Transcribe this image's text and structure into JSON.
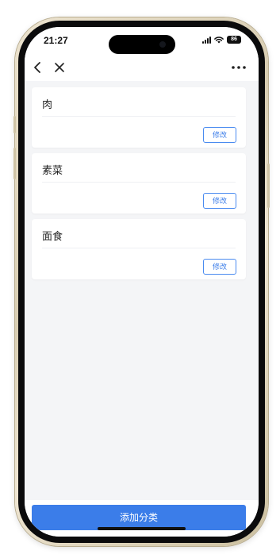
{
  "status_bar": {
    "time": "21:27",
    "battery": "86",
    "icons": [
      "signal-icon",
      "wifi-icon",
      "battery-icon"
    ]
  },
  "nav": {
    "back_icon": "chevron-left-icon",
    "close_icon": "close-icon",
    "more_icon": "more-horizontal-icon"
  },
  "categories": [
    {
      "name": "肉",
      "edit_label": "修改"
    },
    {
      "name": "素菜",
      "edit_label": "修改"
    },
    {
      "name": "面食",
      "edit_label": "修改"
    }
  ],
  "footer": {
    "add_label": "添加分类"
  },
  "colors": {
    "accent": "#3b7de9",
    "background": "#f4f5f7",
    "card": "#ffffff"
  }
}
